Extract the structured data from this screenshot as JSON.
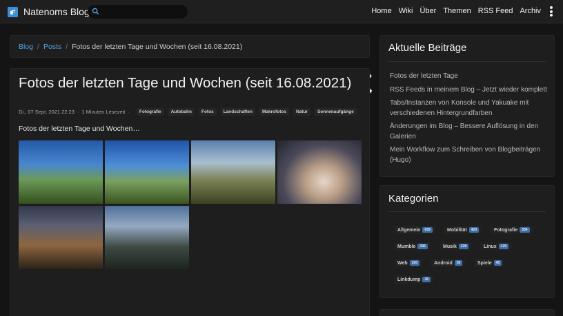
{
  "navbar": {
    "brand": "Natenoms Blog",
    "search_placeholder": "",
    "links": [
      "Home",
      "Wiki",
      "Über",
      "Themen",
      "RSS Feed",
      "Archiv"
    ]
  },
  "breadcrumb": {
    "items": [
      "Blog",
      "Posts"
    ],
    "current": "Fotos der letzten Tage und Wochen (seit 16.08.2021)"
  },
  "post": {
    "title": "Fotos der letzten Tage und Wochen (seit 16.08.2021)",
    "date": "Di., 07 Sept. 2021 22:23",
    "reading_time": "1 Minuten Lesezeit",
    "tags": [
      "Fotografie",
      "Autobahn",
      "Fotos",
      "Landschaften",
      "Makrofotos",
      "Natur",
      "Sonnenaufgänge"
    ],
    "lead": "Fotos der letzten Tage und Wochen…"
  },
  "recent": {
    "title": "Aktuelle Beiträge",
    "items": [
      "Fotos der letzten Tage",
      "RSS Feeds in meinem Blog – Jetzt wieder komplett",
      "Tabs/Instanzen von Konsole und Yakuake mit verschiedenen Hintergrundfarben",
      "Änderungen im Blog – Bessere Auflösung in den Galerien",
      "Mein Workflow zum Schreiben von Blogbeiträgen (Hugo)"
    ]
  },
  "categories": {
    "title": "Kategorien",
    "items": [
      {
        "name": "Allgemein",
        "count": "639"
      },
      {
        "name": "Mobilität",
        "count": "420"
      },
      {
        "name": "Fotografie",
        "count": "334"
      },
      {
        "name": "Mumble",
        "count": "306"
      },
      {
        "name": "Musik",
        "count": "228"
      },
      {
        "name": "Linux",
        "count": "129"
      },
      {
        "name": "Web",
        "count": "100"
      },
      {
        "name": "Android",
        "count": "50"
      },
      {
        "name": "Spiele",
        "count": "45"
      },
      {
        "name": "Linkdump",
        "count": "36"
      }
    ]
  },
  "colors": {
    "accent": "#4ea3e8",
    "badge": "#3f6fa8",
    "background": "#141414",
    "card": "#1e1e1e"
  },
  "icons": [
    "logo-icon",
    "search-icon",
    "more-vertical-icon",
    "expand-width-icon",
    "comments-icon"
  ]
}
